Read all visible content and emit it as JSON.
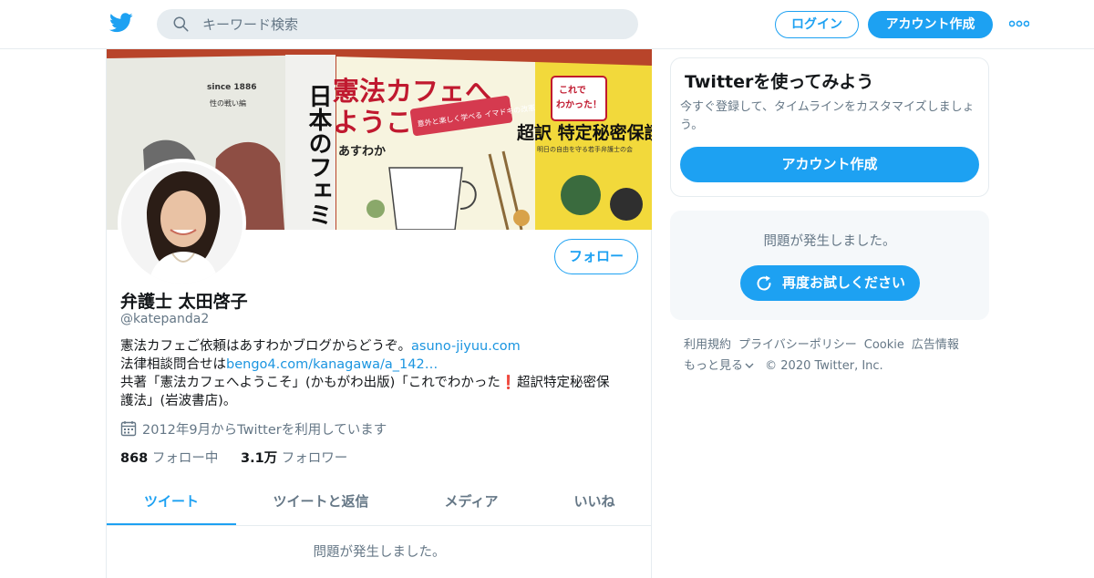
{
  "search": {
    "placeholder": "キーワード検索"
  },
  "header": {
    "login_label": "ログイン",
    "signup_label": "アカウント作成"
  },
  "banner": {
    "book1_title": "日本のフェミニズム",
    "book1_small": "since 1886",
    "book1_sub": "性の戦い編",
    "book2_title_line1": "憲法カフェへ",
    "book2_title_line2": "ようこそ",
    "book2_author": "あすわか",
    "book2_badge": "意外と楽しく学べる イマドキの改憲",
    "book3_line1": "これで",
    "book3_line2": "わかった！",
    "book3_main": "超訳 特定秘密保護法",
    "book3_sub": "明日の自由を守る若手弁護士の会"
  },
  "profile": {
    "name": "弁護士 太田啓子",
    "handle": "@katepanda2",
    "follow_label": "フォロー",
    "bio_line1_text": "憲法カフェご依頼はあすわかブログからどうぞ。",
    "bio_line1_link": "asuno-jiyuu.com",
    "bio_line2_text": "法律相談問合せは",
    "bio_line2_link": "bengo4.com/kanagawa/a_142…",
    "bio_line3_a": "共著「憲法カフェへようこそ」(かもがわ出版)「これでわかった",
    "bio_line3_excl": "❗",
    "bio_line3_b": "超訳特定秘密保",
    "bio_line4": "護法」(岩波書店)。",
    "joined": "2012年9月からTwitterを利用しています",
    "following_count": "868",
    "following_label": "フォロー中",
    "followers_count": "3.1万",
    "followers_label": "フォロワー"
  },
  "tabs": [
    {
      "label": "ツイート",
      "active": true
    },
    {
      "label": "ツイートと返信",
      "active": false
    },
    {
      "label": "メディア",
      "active": false
    },
    {
      "label": "いいね",
      "active": false
    }
  ],
  "timeline_error": "問題が発生しました。",
  "signup_card": {
    "title": "Twitterを使ってみよう",
    "text": "今すぐ登録して、タイムラインをカスタマイズしましょう。",
    "button": "アカウント作成"
  },
  "error_panel": {
    "message": "問題が発生しました。",
    "retry_label": "再度お試しください"
  },
  "footer": {
    "links": [
      "利用規約",
      "プライバシーポリシー",
      "Cookie",
      "広告情報"
    ],
    "more_label": "もっと見る",
    "copyright": "© 2020 Twitter, Inc."
  },
  "colors": {
    "brand": "#1da1f2",
    "text_secondary": "#657786",
    "border": "#e6ecf0",
    "panel_bg": "#f5f8fa"
  }
}
